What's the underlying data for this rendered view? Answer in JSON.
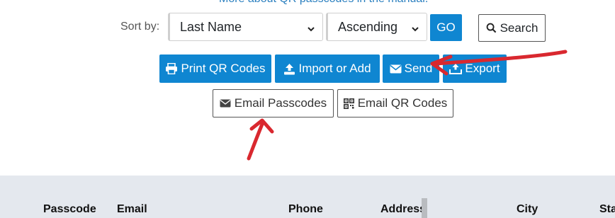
{
  "top_link": "More about QR passcodes in the manual.",
  "sort": {
    "label": "Sort by:",
    "field_value": "Last Name",
    "order_value": "Ascending",
    "go_label": "GO",
    "search_label": "Search"
  },
  "actions": {
    "print_label": "Print QR Codes",
    "import_label": "Import or Add",
    "send_label": "Send",
    "export_label": "Export",
    "email_passcodes_label": "Email Passcodes",
    "email_qr_label": "Email QR Codes"
  },
  "table": {
    "columns": [
      "Passcode",
      "Email",
      "Phone",
      "Address",
      "City",
      "Sta"
    ]
  },
  "colors": {
    "primary": "#0f86d1",
    "annotation": "#d9282f",
    "header_bg": "#e4e8ee"
  }
}
